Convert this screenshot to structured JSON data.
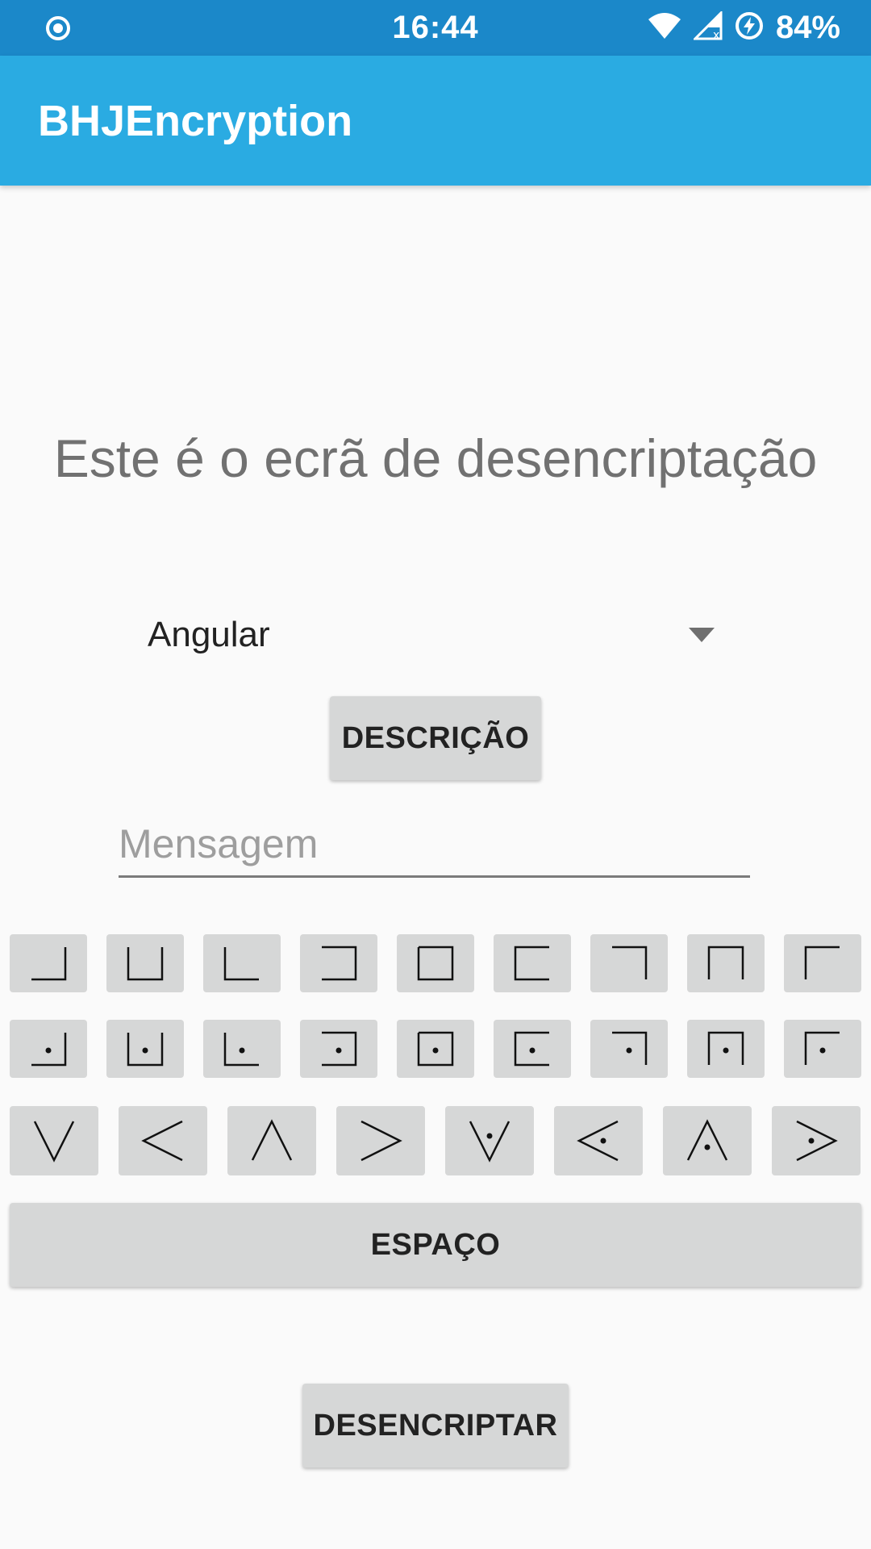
{
  "status_bar": {
    "time": "16:44",
    "battery": "84%"
  },
  "app_bar": {
    "title": "BHJEncryption"
  },
  "main": {
    "headline": "Este é o ecrã de desencriptação",
    "cipher_select": {
      "value": "Angular"
    },
    "description_button": "DESCRIÇÃO",
    "message_input": {
      "placeholder": "Mensagem"
    },
    "space_button": "ESPAÇO",
    "decrypt_button": "DESENCRIPTAR"
  },
  "keyboard": {
    "row1": [
      "grid-bottom-right",
      "grid-bottom-middle",
      "grid-bottom-left",
      "grid-middle-right",
      "grid-center",
      "grid-middle-left",
      "grid-top-right",
      "grid-top-middle",
      "grid-top-left"
    ],
    "row2": [
      "grid-bottom-right-dot",
      "grid-bottom-middle-dot",
      "grid-bottom-left-dot",
      "grid-middle-right-dot",
      "grid-center-dot",
      "grid-middle-left-dot",
      "grid-top-right-dot",
      "grid-top-middle-dot",
      "grid-top-left-dot"
    ],
    "row3": [
      "v-up",
      "v-right",
      "v-down",
      "v-left",
      "v-up-dot",
      "v-right-dot",
      "v-down-dot",
      "v-left-dot"
    ]
  }
}
